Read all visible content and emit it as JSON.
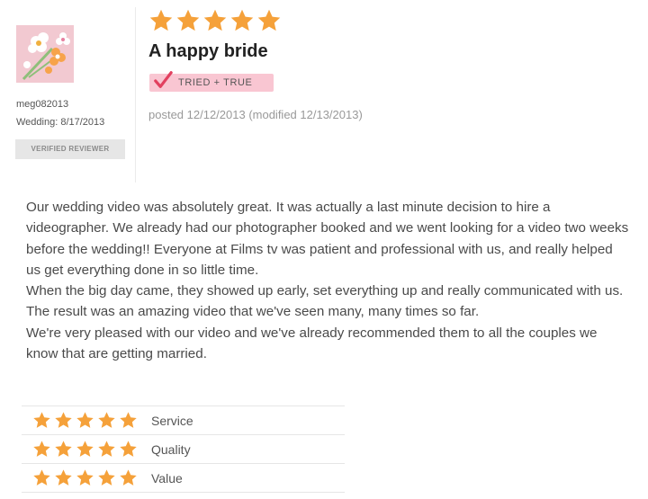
{
  "review": {
    "reviewer": {
      "name": "meg082013",
      "wedding": "Wedding: 8/17/2013",
      "badge": "VERIFIED REVIEWER",
      "avatar_icon": "flower-bouquet-avatar"
    },
    "overall_rating": 5,
    "rating_max": 5,
    "title": "A happy bride",
    "tag": "TRIED + TRUE",
    "posted": "posted 12/12/2013 (modified 12/13/2013)",
    "paragraphs": [
      "Our wedding video was absolutely great. It was actually a last minute decision to hire a videographer. We already had our photographer booked and we went looking for a video two weeks before the wedding!! Everyone at Films tv was patient and professional with us, and really helped us get everything done in so little time.",
      "When the big day came, they showed up early, set everything up and really communicated with us. The result was an amazing video that we've seen many, many times so far.",
      "We're very pleased with our video and we've already recommended them to all the couples we know that are getting married."
    ],
    "category_ratings": [
      {
        "label": "Service",
        "stars": 5
      },
      {
        "label": "Quality",
        "stars": 5
      },
      {
        "label": "Value",
        "stars": 5
      }
    ]
  },
  "colors": {
    "star": "#f5a13a",
    "tag_background": "#f9c6d2",
    "check": "#e2405f",
    "badge_background": "#e6e6e6"
  }
}
